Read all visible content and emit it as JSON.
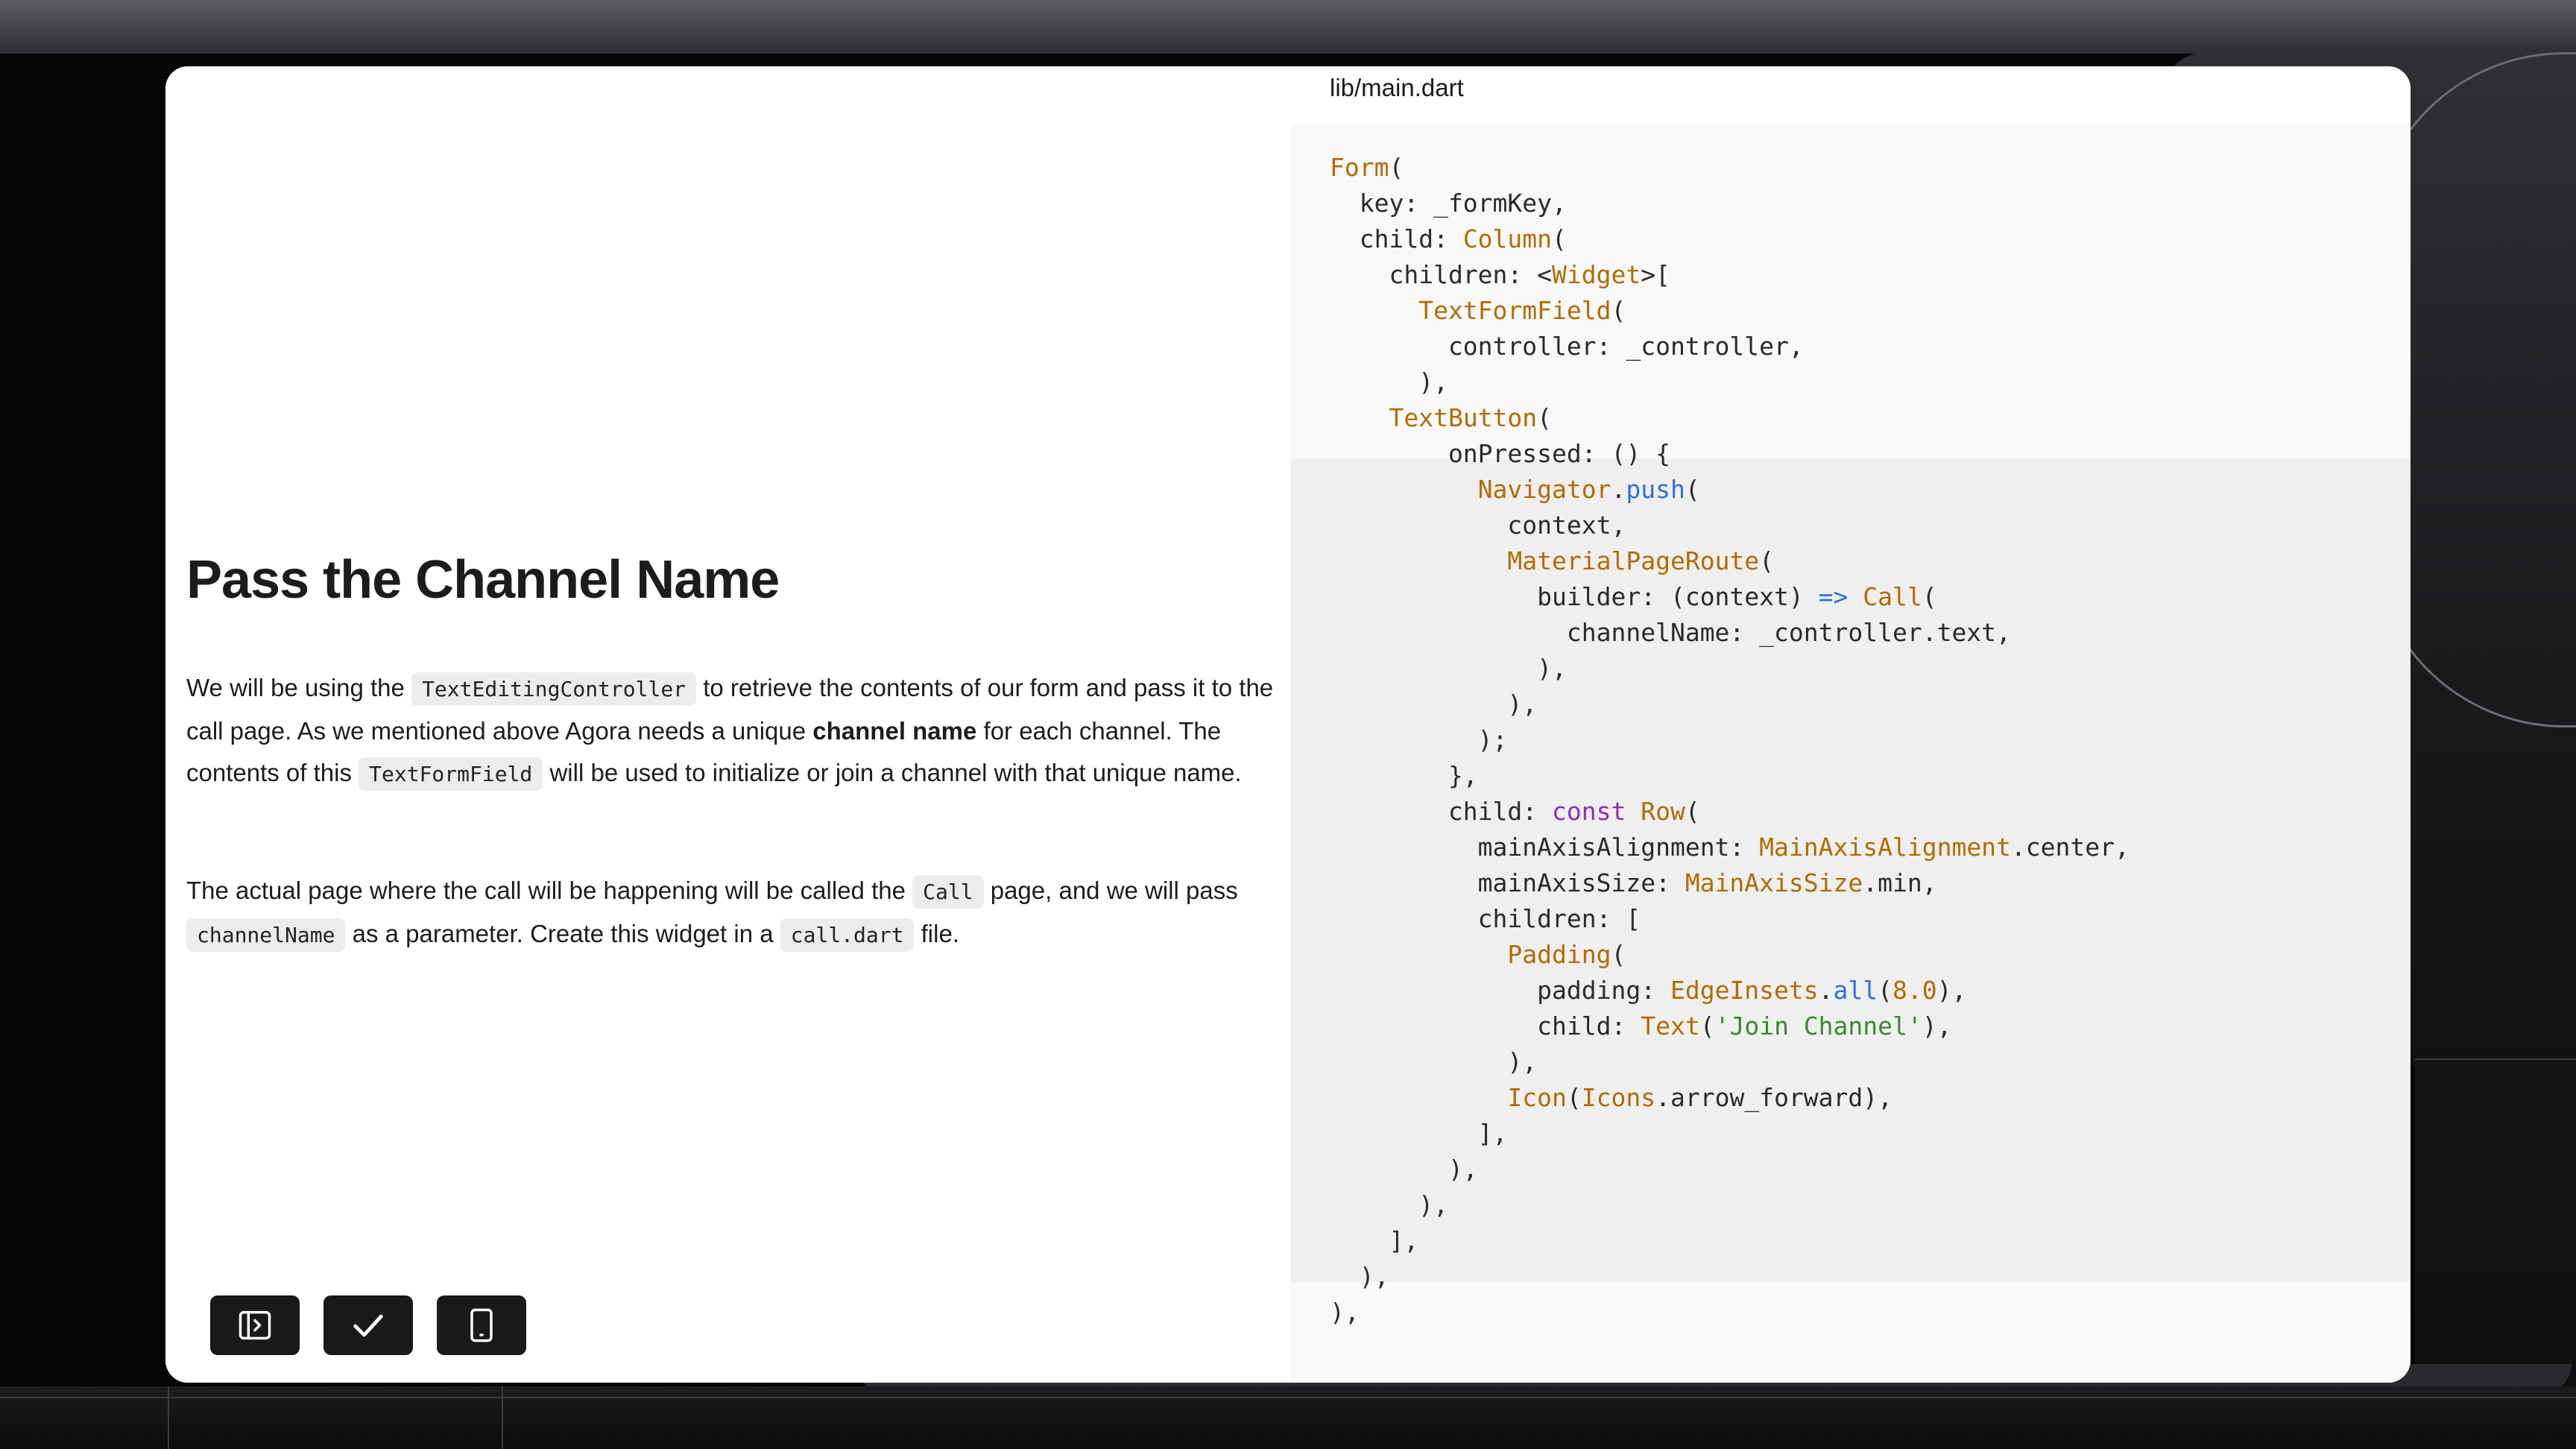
{
  "lesson": {
    "title": "Pass the Channel Name",
    "p1": {
      "t1": "We will be using the ",
      "c1": "TextEditingController",
      "t2": " to retrieve the contents of our form and pass it to the call page. As we mentioned above Agora needs a unique ",
      "bold": "channel name",
      "t3": " for each channel. The contents of this ",
      "c2": "TextFormField",
      "t4": " will be used to initialize or join a channel with that unique name."
    },
    "p2": {
      "t1": "The actual page where the call will be happening will be called the ",
      "c1": "Call",
      "t2": " page, and we will pass ",
      "c2": "channelName",
      "t3": " as a parameter. Create this widget in a ",
      "c3": "call.dart",
      "t4": " file."
    }
  },
  "toolbar": {
    "buttons": [
      {
        "icon": "sidebar-toggle-icon"
      },
      {
        "icon": "check-icon"
      },
      {
        "icon": "mobile-preview-icon"
      }
    ]
  },
  "editor": {
    "filename": "lib/main.dart",
    "lines": [
      "Form(",
      "  key: _formKey,",
      "  child: Column(",
      "    children: <Widget>[",
      "      TextFormField(",
      "        controller: _controller,",
      "      ),",
      "    TextButton(",
      "        onPressed: () {",
      "          Navigator.push(",
      "            context,",
      "            MaterialPageRoute(",
      "              builder: (context) => Call(",
      "                channelName: _controller.text,",
      "              ),",
      "            ),",
      "          );",
      "        },",
      "        child: const Row(",
      "          mainAxisAlignment: MainAxisAlignment.center,",
      "          mainAxisSize: MainAxisSize.min,",
      "          children: [",
      "            Padding(",
      "              padding: EdgeInsets.all(8.0),",
      "              child: Text('Join Channel'),",
      "            ),",
      "            Icon(Icons.arrow_forward),",
      "          ],",
      "        ),",
      "      ),",
      "    ],",
      "  ),",
      "),"
    ],
    "highlight_lines": [
      8,
      31
    ],
    "colors": {
      "type": "#b36b00",
      "method": "#2f6fdb",
      "keyword": "#8a2dbb",
      "string": "#3a8a2e",
      "number": "#b36b00"
    }
  }
}
